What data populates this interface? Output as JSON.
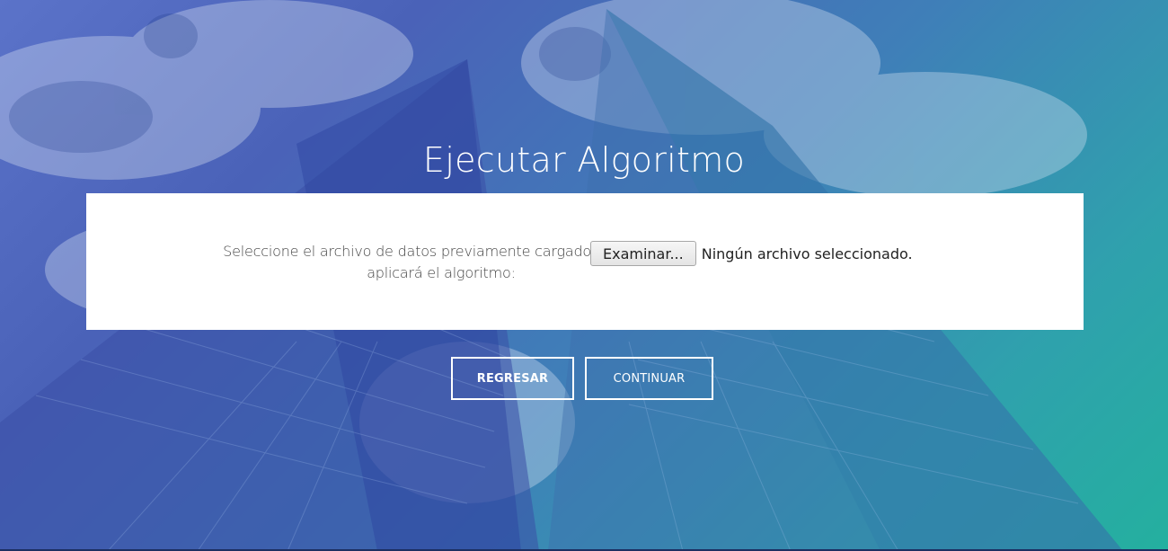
{
  "page": {
    "title": "Ejecutar Algoritmo"
  },
  "form": {
    "label": "Seleccione el archivo de datos previamente cargado al que se aplicará el algoritmo:",
    "browse_label": "Examinar...",
    "file_status": "Ningún archivo seleccionado."
  },
  "actions": {
    "back_label": "REGRESAR",
    "continue_label": "CONTINUAR"
  },
  "colors": {
    "overlay_left": "#5b73c9",
    "overlay_right": "#24b09f",
    "card": "#ffffff"
  }
}
